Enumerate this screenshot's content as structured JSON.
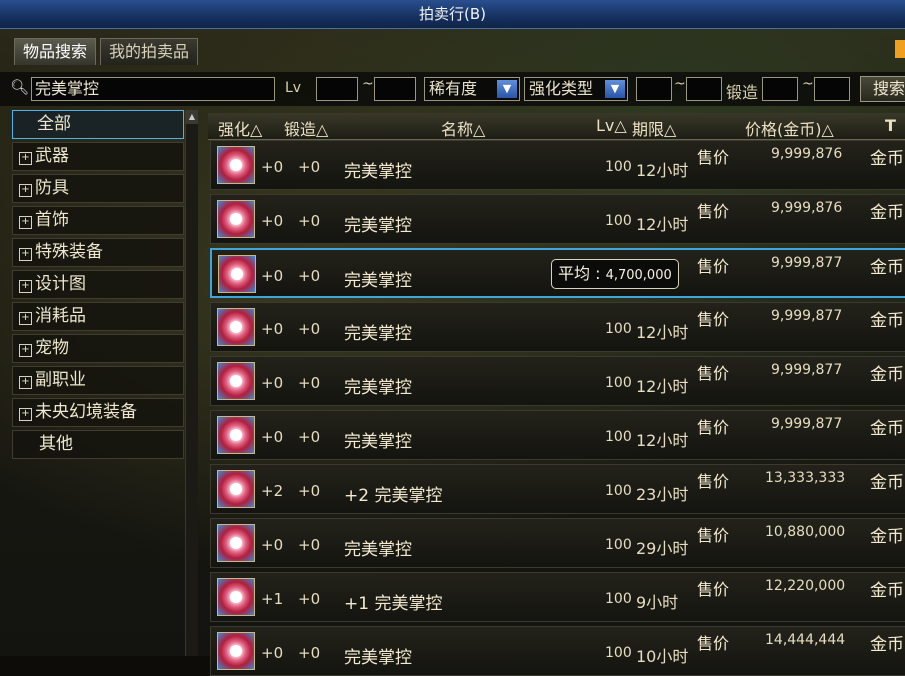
{
  "window": {
    "title": "拍卖行(B)"
  },
  "tabs": [
    {
      "label": "物品搜索",
      "active": true
    },
    {
      "label": "我的拍卖品",
      "active": false
    }
  ],
  "search": {
    "query": "完美掌控",
    "lv_label": "Lv",
    "tilde": "~",
    "rarity": "稀有度",
    "enhance_type": "强化类型",
    "forge_label": "锻造",
    "search_button": "搜索"
  },
  "categories": [
    {
      "label": "全部",
      "selected": true,
      "expandable": false
    },
    {
      "label": "武器",
      "expandable": true
    },
    {
      "label": "防具",
      "expandable": true
    },
    {
      "label": "首饰",
      "expandable": true
    },
    {
      "label": "特殊装备",
      "expandable": true
    },
    {
      "label": "设计图",
      "expandable": true
    },
    {
      "label": "消耗品",
      "expandable": true
    },
    {
      "label": "宠物",
      "expandable": true
    },
    {
      "label": "副职业",
      "expandable": true
    },
    {
      "label": "未央幻境装备",
      "expandable": true
    },
    {
      "label": "其他",
      "expandable": false
    }
  ],
  "table": {
    "headers": {
      "enhance": "强化△",
      "forge": "锻造△",
      "name": "名称△",
      "lv": "Lv△",
      "duration": "期限△",
      "price": "价格(金币)△",
      "tool": "T"
    },
    "rows": [
      {
        "enhance": "+0",
        "forge": "+0",
        "name": "完美掌控",
        "lv": "100",
        "duration": "12小时",
        "sale": "售价",
        "price": "9,999,876",
        "currency": "金币"
      },
      {
        "enhance": "+0",
        "forge": "+0",
        "name": "完美掌控",
        "lv": "100",
        "duration": "12小时",
        "sale": "售价",
        "price": "9,999,876",
        "currency": "金币"
      },
      {
        "enhance": "+0",
        "forge": "+0",
        "name": "完美掌控",
        "lv": "",
        "duration": "",
        "sale": "售价",
        "price": "9,999,877",
        "currency": "金币",
        "selected": true
      },
      {
        "enhance": "+0",
        "forge": "+0",
        "name": "完美掌控",
        "lv": "100",
        "duration": "12小时",
        "sale": "售价",
        "price": "9,999,877",
        "currency": "金币"
      },
      {
        "enhance": "+0",
        "forge": "+0",
        "name": "完美掌控",
        "lv": "100",
        "duration": "12小时",
        "sale": "售价",
        "price": "9,999,877",
        "currency": "金币"
      },
      {
        "enhance": "+0",
        "forge": "+0",
        "name": "完美掌控",
        "lv": "100",
        "duration": "12小时",
        "sale": "售价",
        "price": "9,999,877",
        "currency": "金币"
      },
      {
        "enhance": "+2",
        "forge": "+0",
        "name": "+2 完美掌控",
        "lv": "100",
        "duration": "23小时",
        "sale": "售价",
        "price": "13,333,333",
        "currency": "金币"
      },
      {
        "enhance": "+0",
        "forge": "+0",
        "name": "完美掌控",
        "lv": "100",
        "duration": "29小时",
        "sale": "售价",
        "price": "10,880,000",
        "currency": "金币"
      },
      {
        "enhance": "+1",
        "forge": "+0",
        "name": "+1 完美掌控",
        "lv": "100",
        "duration": "9小时",
        "sale": "售价",
        "price": "12,220,000",
        "currency": "金币"
      },
      {
        "enhance": "+0",
        "forge": "+0",
        "name": "完美掌控",
        "lv": "100",
        "duration": "10小时",
        "sale": "售价",
        "price": "14,444,444",
        "currency": "金币"
      }
    ]
  },
  "tooltip": {
    "label": "平均 : ",
    "value": "4,700,000"
  },
  "colors": {
    "selection": "#3fa6dc",
    "title_bar": "#1e3f78"
  },
  "icons": {
    "item": "perfect-control-gem-icon",
    "search": "search-icon",
    "dropdown": "chevron-down-icon"
  }
}
